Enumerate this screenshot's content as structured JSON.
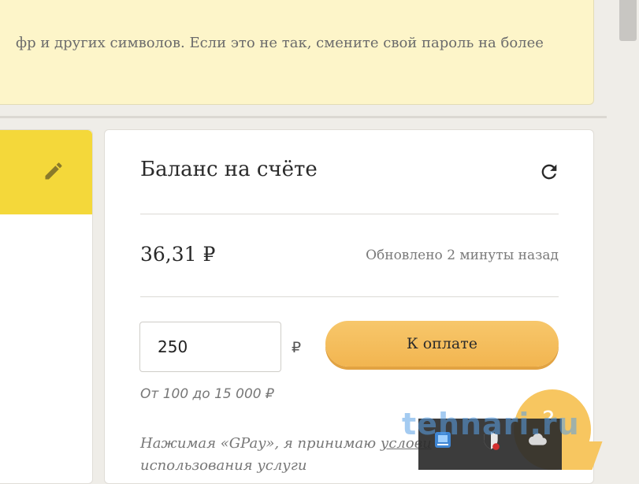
{
  "notice": {
    "text": "фр и других символов. Если это не так, смените свой пароль на более"
  },
  "balance_card": {
    "title": "Баланс на счёте",
    "balance": "36,31 ₽",
    "updated": "Обновлено 2 минуты назад",
    "amount_value": "250",
    "currency": "₽",
    "pay_label": "К оплате",
    "limit": "От 100 до 15 000 ₽",
    "terms_prefix": "Нажимая «GPay», я принимаю",
    "terms_link": "услови",
    "terms_line2": "использования услуги"
  },
  "icons": {
    "edit": "pencil-icon",
    "refresh": "refresh-icon",
    "chat": "chat-bubble-icon",
    "tray": [
      "network-icon",
      "shield-icon",
      "cloud-icon"
    ]
  },
  "chat": {
    "mark": "?"
  },
  "watermark": "tehnari.ru",
  "colors": {
    "notice_bg": "#fdf5c9",
    "accent_yellow": "#f4d83a",
    "button": "#f2b550"
  }
}
